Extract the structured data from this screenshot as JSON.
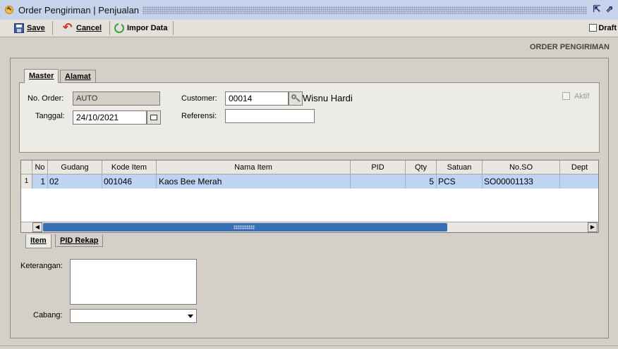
{
  "window": {
    "title": "Order Pengiriman | Penjualan"
  },
  "toolbar": {
    "save": "Save",
    "cancel": "Cancel",
    "import": "Impor Data",
    "draft": "Draft"
  },
  "header_title": "ORDER PENGIRIMAN",
  "tabs_top": [
    "Master",
    "Alamat"
  ],
  "form": {
    "no_order_label": "No. Order:",
    "no_order_value": "AUTO",
    "tanggal_label": "Tanggal:",
    "tanggal_value": "24/10/2021",
    "customer_label": "Customer:",
    "customer_code": "00014",
    "customer_name": "Wisnu Hardi",
    "referensi_label": "Referensi:",
    "referensi_value": "",
    "aktif_label": "Aktif"
  },
  "grid": {
    "columns": [
      "No",
      "Gudang",
      "Kode Item",
      "Nama Item",
      "PID",
      "Qty",
      "Satuan",
      "No.SO",
      "Dept"
    ],
    "rows": [
      {
        "sel": "1",
        "no": "1",
        "gudang": "02",
        "kode": "001046",
        "nama": "Kaos Bee Merah",
        "pid": "",
        "qty": "5",
        "satuan": "PCS",
        "noso": "SO00001133",
        "dept": ""
      }
    ]
  },
  "tabs_bottom": [
    "Item",
    "PID Rekap"
  ],
  "bottom": {
    "keterangan_label": "Keterangan:",
    "cabang_label": "Cabang:",
    "cabang_value": ""
  },
  "icons": {
    "app": "app-icon",
    "save": "save-icon",
    "cancel": "undo-icon",
    "import": "refresh-icon",
    "calendar": "calendar-icon",
    "lookup": "key-icon"
  }
}
